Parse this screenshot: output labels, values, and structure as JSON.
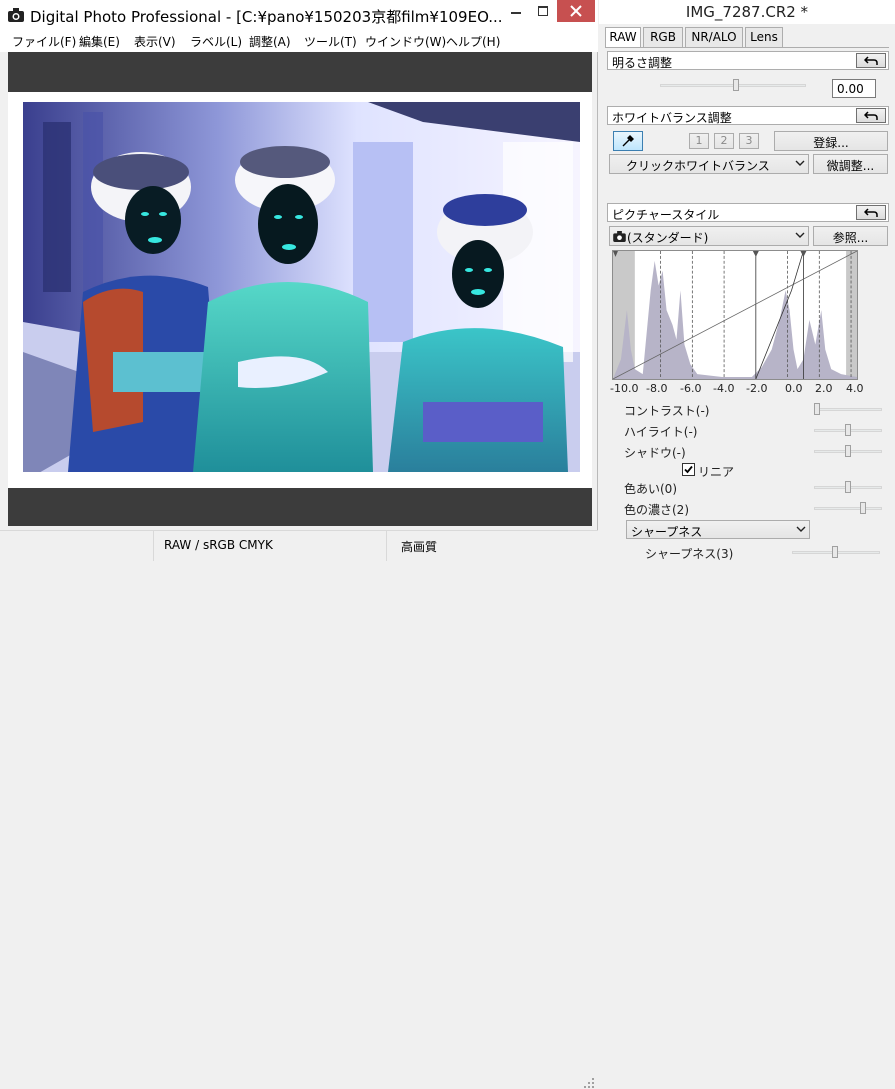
{
  "main": {
    "title": "Digital Photo Professional - [C:¥pano¥150203京都film¥109EO...",
    "menu": [
      "ファイル(F)",
      "編集(E)",
      "表示(V)",
      "ラベル(L)",
      "調整(A)",
      "ツール(T)",
      "ウインドウ(W)",
      "ヘルプ(H)"
    ],
    "status": {
      "profile": "RAW / sRGB  CMYK",
      "quality": "高画質"
    }
  },
  "palette": {
    "title": "IMG_7287.CR2 *",
    "tabs": [
      "RAW",
      "RGB",
      "NR/ALO",
      "Lens"
    ],
    "brightness": {
      "header": "明るさ調整",
      "value": "0.00"
    },
    "white_balance": {
      "header": "ホワイトバランス調整",
      "slots": [
        "1",
        "2",
        "3"
      ],
      "register": "登録...",
      "mode": "クリックホワイトバランス",
      "fine": "微調整..."
    },
    "picture_style": {
      "header": "ピクチャースタイル",
      "style": "(スタンダード)",
      "browse": "参照...",
      "axis": [
        "-10.0",
        "-8.0",
        "-6.0",
        "-4.0",
        "-2.0",
        "0.0",
        "2.0",
        "4.0"
      ],
      "params": {
        "contrast": "コントラスト(-)",
        "highlight": "ハイライト(-)",
        "shadow": "シャドウ(-)",
        "linear": "リニア",
        "hue": "色あい(0)",
        "saturation": "色の濃さ(2)",
        "sharpness_mode": "シャープネス",
        "sharpness": "シャープネス(3)"
      }
    }
  },
  "colors": {
    "close_button": "#c75050",
    "viewer_frame": "#3c3c3c",
    "histogram_fill": "#b7b4c8"
  }
}
